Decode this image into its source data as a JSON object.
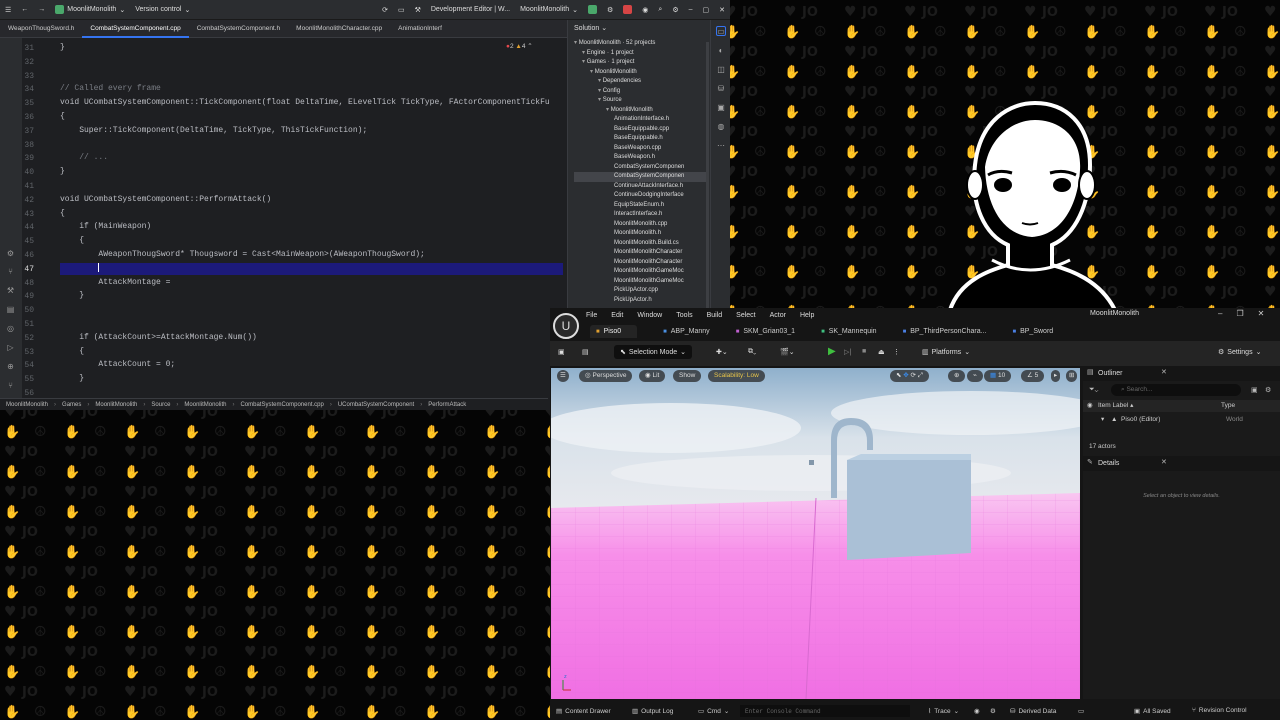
{
  "ide": {
    "project": "MoonlitMonolith",
    "version_control": "Version control",
    "config": "Development Editor | W...",
    "run_target": "MoonlitMonolith",
    "tabs": [
      "WeaponThougSword.h",
      "CombatSystemComponent.cpp",
      "CombatSystemComponent.h",
      "MoonlitMonolithCharacter.cpp",
      "AnimationInterf"
    ],
    "active_tab": 1,
    "warnings": "2",
    "errors": "4",
    "code_lines": [
      {
        "n": "31",
        "text": "}"
      },
      {
        "n": "32",
        "text": ""
      },
      {
        "n": "33",
        "text": ""
      },
      {
        "n": "34",
        "text": "// Called every frame"
      },
      {
        "n": "35",
        "text": "void UCombatSystemComponent::TickComponent(float DeltaTime, ELevelTick TickType, FActorComponentTickFu"
      },
      {
        "n": "36",
        "text": "{"
      },
      {
        "n": "37",
        "text": "    Super::TickComponent(DeltaTime, TickType, ThisTickFunction);"
      },
      {
        "n": "38",
        "text": ""
      },
      {
        "n": "39",
        "text": "    // ..."
      },
      {
        "n": "40",
        "text": "}"
      },
      {
        "n": "41",
        "text": ""
      },
      {
        "n": "42",
        "text": "void UCombatSystemComponent::PerformAttack()"
      },
      {
        "n": "43",
        "text": "{"
      },
      {
        "n": "44",
        "text": "    if (MainWeapon)"
      },
      {
        "n": "45",
        "text": "    {"
      },
      {
        "n": "46",
        "text": "        AWeaponThougSword* Thougsword = Cast<MainWeapon>(AWeaponThougSword);"
      },
      {
        "n": "47",
        "text": "        "
      },
      {
        "n": "48",
        "text": "        AttackMontage = "
      },
      {
        "n": "49",
        "text": "    }"
      },
      {
        "n": "50",
        "text": ""
      },
      {
        "n": "51",
        "text": ""
      },
      {
        "n": "52",
        "text": "    if (AttackCount>=AttackMontage.Num())"
      },
      {
        "n": "53",
        "text": "    {"
      },
      {
        "n": "54",
        "text": "        AttackCount = 0;"
      },
      {
        "n": "55",
        "text": "    }"
      },
      {
        "n": "56",
        "text": ""
      }
    ],
    "breadcrumb": [
      "MoonlitMonolith",
      "Games",
      "MoonlitMonolith",
      "Source",
      "MoonlitMonolith",
      "CombatSystemComponent.cpp",
      "UCombatSystemComponent",
      "PerformAttack"
    ],
    "solution": {
      "title": "Solution",
      "items": [
        {
          "label": "MoonlitMonolith · 52 projects",
          "depth": 0
        },
        {
          "label": "Engine · 1 project",
          "depth": 1
        },
        {
          "label": "Games · 1 project",
          "depth": 1
        },
        {
          "label": "MoonlitMonolith",
          "depth": 2
        },
        {
          "label": "Dependencies",
          "depth": 3
        },
        {
          "label": "Config",
          "depth": 3
        },
        {
          "label": "Source",
          "depth": 3
        },
        {
          "label": "MoonlitMonolith",
          "depth": 4
        },
        {
          "label": "AnimationInterface.h",
          "depth": 5
        },
        {
          "label": "BaseEquippable.cpp",
          "depth": 5
        },
        {
          "label": "BaseEquippable.h",
          "depth": 5
        },
        {
          "label": "BaseWeapon.cpp",
          "depth": 5
        },
        {
          "label": "BaseWeapon.h",
          "depth": 5
        },
        {
          "label": "CombatSystemComponen",
          "depth": 5
        },
        {
          "label": "CombatSystemComponen",
          "depth": 5,
          "selected": true
        },
        {
          "label": "ContinueAttackInterface.h",
          "depth": 5
        },
        {
          "label": "ContinueDodgingInterface",
          "depth": 5
        },
        {
          "label": "EquipStateEnum.h",
          "depth": 5
        },
        {
          "label": "InteractInterface.h",
          "depth": 5
        },
        {
          "label": "MoonlitMonolith.cpp",
          "depth": 5
        },
        {
          "label": "MoonlitMonolith.h",
          "depth": 5
        },
        {
          "label": "MoonlitMonolith.Build.cs",
          "depth": 5
        },
        {
          "label": "MoonlitMonolithCharacter",
          "depth": 5
        },
        {
          "label": "MoonlitMonolithCharacter",
          "depth": 5
        },
        {
          "label": "MoonlitMonolithGameMoc",
          "depth": 5
        },
        {
          "label": "MoonlitMonolithGameMoc",
          "depth": 5
        },
        {
          "label": "PickUpActor.cpp",
          "depth": 5
        },
        {
          "label": "PickUpActor.h",
          "depth": 5
        }
      ]
    }
  },
  "unreal": {
    "window_title": "MoonlitMonolith",
    "menu": [
      "File",
      "Edit",
      "Window",
      "Tools",
      "Build",
      "Select",
      "Actor",
      "Help"
    ],
    "tabs": [
      "Piso0",
      "ABP_Manny",
      "SKM_Grian03_1",
      "SK_Mannequin",
      "BP_ThirdPersonChara...",
      "BP_Sword"
    ],
    "toolbar": {
      "mode": "Selection Mode",
      "platforms": "Platforms",
      "settings": "Settings"
    },
    "viewport": {
      "perspective": "Perspective",
      "lit": "Lit",
      "show": "Show",
      "scalability": "Scalability: Low",
      "grid": "10",
      "angle": "5"
    },
    "outliner": {
      "title": "Outliner",
      "search_placeholder": "Search...",
      "col_label": "Item Label",
      "col_type": "Type",
      "row_label": "Piso0 (Editor)",
      "row_type": "World",
      "count": "17 actors"
    },
    "details": {
      "title": "Details",
      "empty": "Select an object to view details."
    },
    "status": {
      "content_drawer": "Content Drawer",
      "output_log": "Output Log",
      "cmd": "Cmd",
      "console_placeholder": "Enter Console Command",
      "trace": "Trace",
      "derived": "Derived Data",
      "saved": "All Saved",
      "revision": "Revision Control"
    }
  },
  "colors": {
    "accent": "#3574f0",
    "selection_line": "#1c1a7a",
    "floor": "#f48ae8",
    "play": "#3fbf3f"
  }
}
